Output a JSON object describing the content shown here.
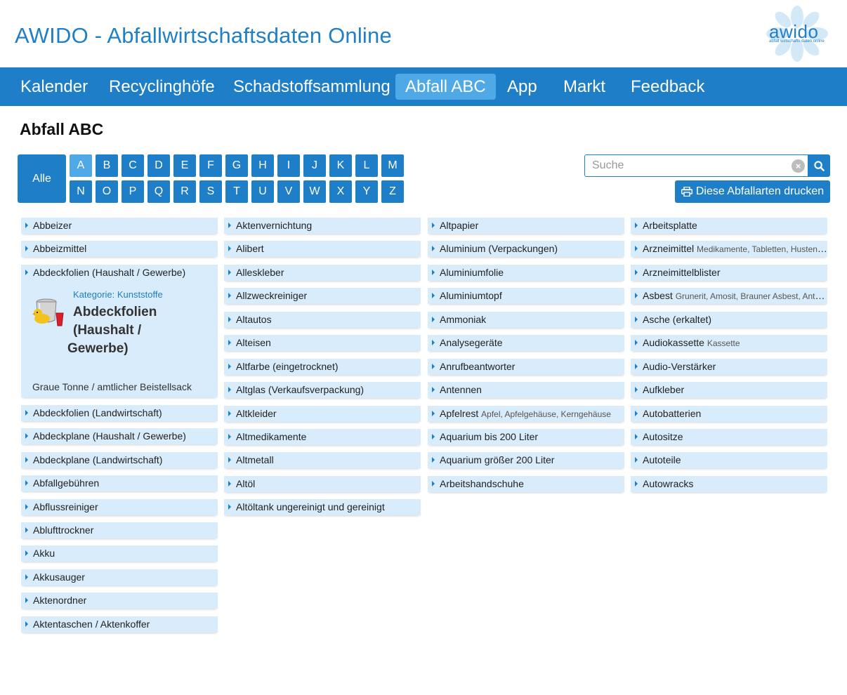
{
  "header": {
    "title": "AWIDO - Abfallwirtschaftsdaten Online",
    "logo_text": "awido",
    "logo_sub": "abfall wirtschafts daten online"
  },
  "nav": [
    "Kalender",
    "Recyclinghöfe",
    "Schadstoffsammlung",
    "Abfall ABC",
    "App",
    "Markt",
    "Feedback"
  ],
  "nav_active": "Abfall ABC",
  "page_title": "Abfall ABC",
  "filter": {
    "all_label": "Alle",
    "letters": [
      "A",
      "B",
      "C",
      "D",
      "E",
      "F",
      "G",
      "H",
      "I",
      "J",
      "K",
      "L",
      "M",
      "N",
      "O",
      "P",
      "Q",
      "R",
      "S",
      "T",
      "U",
      "V",
      "W",
      "X",
      "Y",
      "Z"
    ],
    "active_letter": "A"
  },
  "search": {
    "placeholder": "Suche",
    "value": ""
  },
  "print_label": "Diese Abfallarten drucken",
  "detail": {
    "category": "Kategorie: Kunststoffe",
    "title_lines": [
      "Abdeckfolien",
      "(Haushalt /",
      "Gewerbe)"
    ],
    "bin": "Graue Tonne / amtlicher Beistellsack"
  },
  "columns": [
    [
      {
        "name": "Abbeizer",
        "syn": ""
      },
      {
        "name": "Abbeizmittel",
        "syn": ""
      },
      {
        "name": "Abdeckfolien (Haushalt / Gewerbe)",
        "syn": "",
        "expanded": true
      },
      {
        "name": "Abdeckfolien (Landwirtschaft)",
        "syn": ""
      },
      {
        "name": "Abdeckplane (Haushalt / Gewerbe)",
        "syn": ""
      },
      {
        "name": "Abdeckplane (Landwirtschaft)",
        "syn": ""
      },
      {
        "name": "Abfallgebühren",
        "syn": ""
      },
      {
        "name": "Abflussreiniger",
        "syn": ""
      },
      {
        "name": "Ablufttrockner",
        "syn": ""
      },
      {
        "name": "Akku",
        "syn": ""
      },
      {
        "name": "Akkusauger",
        "syn": ""
      },
      {
        "name": "Aktenordner",
        "syn": ""
      },
      {
        "name": "Aktentaschen / Aktenkoffer",
        "syn": ""
      }
    ],
    [
      {
        "name": "Aktenvernichtung",
        "syn": ""
      },
      {
        "name": "Alibert",
        "syn": ""
      },
      {
        "name": "Alleskleber",
        "syn": ""
      },
      {
        "name": "Allzweckreiniger",
        "syn": ""
      },
      {
        "name": "Altautos",
        "syn": ""
      },
      {
        "name": "Alteisen",
        "syn": ""
      },
      {
        "name": "Altfarbe (eingetrocknet)",
        "syn": ""
      },
      {
        "name": "Altglas (Verkaufsverpackung)",
        "syn": ""
      },
      {
        "name": "Altkleider",
        "syn": ""
      },
      {
        "name": "Altmedikamente",
        "syn": ""
      },
      {
        "name": "Altmetall",
        "syn": ""
      },
      {
        "name": "Altöl",
        "syn": ""
      },
      {
        "name": "Altöltank ungereinigt und gereinigt",
        "syn": ""
      }
    ],
    [
      {
        "name": "Altpapier",
        "syn": ""
      },
      {
        "name": "Aluminium (Verpackungen)",
        "syn": ""
      },
      {
        "name": "Aluminiumfolie",
        "syn": ""
      },
      {
        "name": "Aluminiumtopf",
        "syn": ""
      },
      {
        "name": "Ammoniak",
        "syn": ""
      },
      {
        "name": "Analysegeräte",
        "syn": ""
      },
      {
        "name": "Anrufbeantworter",
        "syn": ""
      },
      {
        "name": "Antennen",
        "syn": ""
      },
      {
        "name": "Apfelrest",
        "syn": "Apfel, Apfelgehäuse, Kerngehäuse"
      },
      {
        "name": "Aquarium bis 200 Liter",
        "syn": ""
      },
      {
        "name": "Aquarium größer 200 Liter",
        "syn": ""
      },
      {
        "name": "Arbeitshandschuhe",
        "syn": ""
      }
    ],
    [
      {
        "name": "Arbeitsplatte",
        "syn": ""
      },
      {
        "name": "Arzneimittel",
        "syn": "Medikamente, Tabletten, Hustensaft"
      },
      {
        "name": "Arzneimittelblister",
        "syn": ""
      },
      {
        "name": "Asbest",
        "syn": "Grunerit, Amosit, Brauner Asbest, Anthophyllit"
      },
      {
        "name": "Asche (erkaltet)",
        "syn": ""
      },
      {
        "name": "Audiokassette",
        "syn": "Kassette"
      },
      {
        "name": "Audio-Verstärker",
        "syn": ""
      },
      {
        "name": "Aufkleber",
        "syn": ""
      },
      {
        "name": "Autobatterien",
        "syn": ""
      },
      {
        "name": "Autositze",
        "syn": ""
      },
      {
        "name": "Autoteile",
        "syn": ""
      },
      {
        "name": "Autowracks",
        "syn": ""
      }
    ]
  ]
}
